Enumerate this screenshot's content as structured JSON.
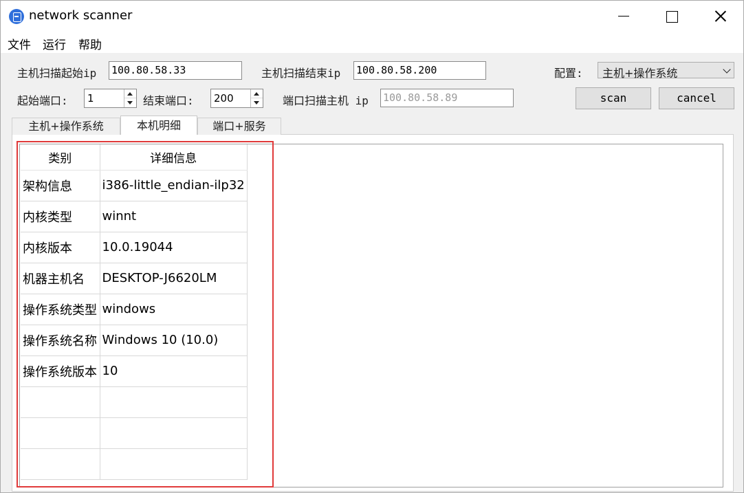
{
  "window": {
    "title": "network scanner"
  },
  "menu": [
    "文件",
    "运行",
    "帮助"
  ],
  "form": {
    "host_start_label": "主机扫描起始ip",
    "host_start_value": "100.80.58.33",
    "host_end_label": "主机扫描结束ip",
    "host_end_value": "100.80.58.200",
    "config_label": "配置:",
    "config_value": "主机+操作系统",
    "start_port_label": "起始端口:",
    "start_port_value": "1",
    "end_port_label": "结束端口:",
    "end_port_value": "200",
    "port_host_label": "端口扫描主机 ip",
    "port_host_placeholder": "100.80.58.89",
    "scan_label": "scan",
    "cancel_label": "cancel"
  },
  "tabs": [
    {
      "label": "主机+操作系统",
      "active": false
    },
    {
      "label": "本机明细",
      "active": true
    },
    {
      "label": "端口+服务",
      "active": false
    }
  ],
  "detail_table": {
    "headers": [
      "类别",
      "详细信息"
    ],
    "rows": [
      [
        "架构信息",
        "i386-little_endian-ilp32"
      ],
      [
        "内核类型",
        "winnt"
      ],
      [
        "内核版本",
        "10.0.19044"
      ],
      [
        "机器主机名",
        "DESKTOP-J6620LM"
      ],
      [
        "操作系统类型",
        "windows"
      ],
      [
        "操作系统名称",
        "Windows 10 (10.0)"
      ],
      [
        "操作系统版本",
        "10"
      ],
      [
        "",
        ""
      ],
      [
        "",
        ""
      ],
      [
        "",
        ""
      ]
    ]
  },
  "colors": {
    "highlight": "#e03a3a",
    "app_icon": "#2f6fdb"
  }
}
